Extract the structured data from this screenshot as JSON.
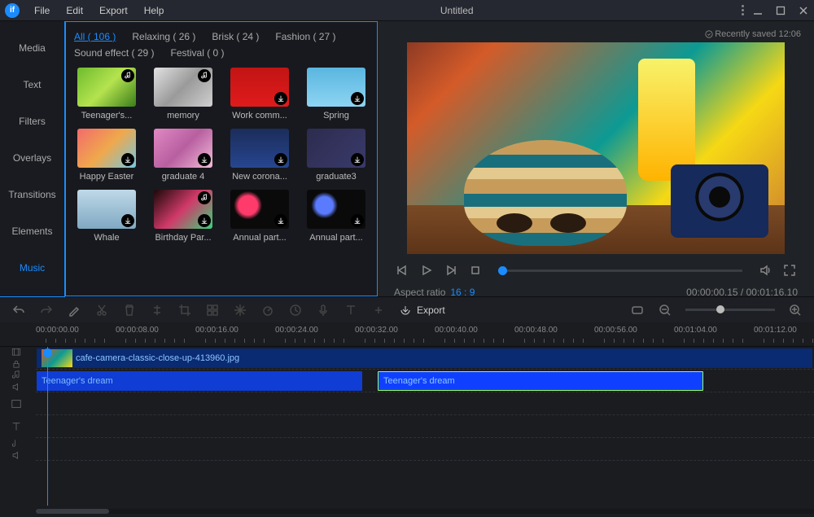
{
  "titlebar": {
    "menus": [
      "File",
      "Edit",
      "Export",
      "Help"
    ],
    "title": "Untitled"
  },
  "sidebar": {
    "items": [
      "Media",
      "Text",
      "Filters",
      "Overlays",
      "Transitions",
      "Elements",
      "Music"
    ],
    "active_index": 6
  },
  "library": {
    "categories": [
      {
        "label": "All",
        "count": 106,
        "active": true
      },
      {
        "label": "Relaxing",
        "count": 26
      },
      {
        "label": "Brisk",
        "count": 24
      },
      {
        "label": "Fashion",
        "count": 27
      },
      {
        "label": "Sound effect",
        "count": 29
      },
      {
        "label": "Festival",
        "count": 0
      }
    ],
    "items": [
      {
        "label": "Teenager's...",
        "bg": "linear-gradient(135deg,#6dbb2e,#b5e34f,#3a7d1a)",
        "music": true
      },
      {
        "label": "memory",
        "bg": "linear-gradient(135deg,#e2e2e2,#9a9a9a,#d0d0d0)",
        "music": true
      },
      {
        "label": "Work comm...",
        "bg": "linear-gradient(180deg,#c21414,#e01b1b)",
        "dl": true
      },
      {
        "label": "Spring",
        "bg": "linear-gradient(180deg,#5ab6e0,#8dd4f2)",
        "dl": true
      },
      {
        "label": "Happy Easter",
        "bg": "linear-gradient(135deg,#f26b6b,#f0a84c,#74c7e0)",
        "dl": true
      },
      {
        "label": "graduate 4",
        "bg": "linear-gradient(135deg,#e089c3,#b85fa0,#f1bcd9)",
        "dl": true
      },
      {
        "label": "New corona...",
        "bg": "linear-gradient(180deg,#1b2d5a,#274690)",
        "dl": true
      },
      {
        "label": "graduate3",
        "bg": "linear-gradient(135deg,#2c2c4f,#3a3a6b)",
        "dl": true
      },
      {
        "label": "Whale",
        "bg": "linear-gradient(180deg,#bfd9e8,#7fa9c2)",
        "dl": true
      },
      {
        "label": "Birthday Par...",
        "bg": "linear-gradient(135deg,#1a0808,#d13a6a,#3ad179)",
        "music": true,
        "dl": true
      },
      {
        "label": "Annual part...",
        "bg": "radial-gradient(circle at 30% 40%,#ff3b6b 0 20%,#0a0a0a 30%),radial-gradient(circle at 70% 60%,#ffae3b 0 18%,transparent 25%)",
        "dl": true
      },
      {
        "label": "Annual part...",
        "bg": "radial-gradient(circle at 30% 40%,#5b7bff 0 18%,#0a0a0a 28%),radial-gradient(circle at 70% 50%,#ff5b9e 0 15%,transparent 22%)",
        "dl": true
      }
    ]
  },
  "preview": {
    "saved_label": "Recently saved 12:06",
    "aspect_label": "Aspect ratio",
    "aspect_value": "16 : 9",
    "time_current": "00:00:00.15",
    "time_total": "00:01:16.10"
  },
  "toolbar": {
    "export_label": "Export"
  },
  "timeline": {
    "ticks": [
      "00:00:00.00",
      "00:00:08.00",
      "00:00:16.00",
      "00:00:24.00",
      "00:00:32.00",
      "00:00:40.00",
      "00:00:48.00",
      "00:00:56.00",
      "00:01:04.00",
      "00:01:12.00"
    ],
    "video_clip": "cafe-camera-classic-close-up-413960.jpg",
    "audio_clip1": "Teenager's dream",
    "audio_clip2": "Teenager's dream"
  }
}
